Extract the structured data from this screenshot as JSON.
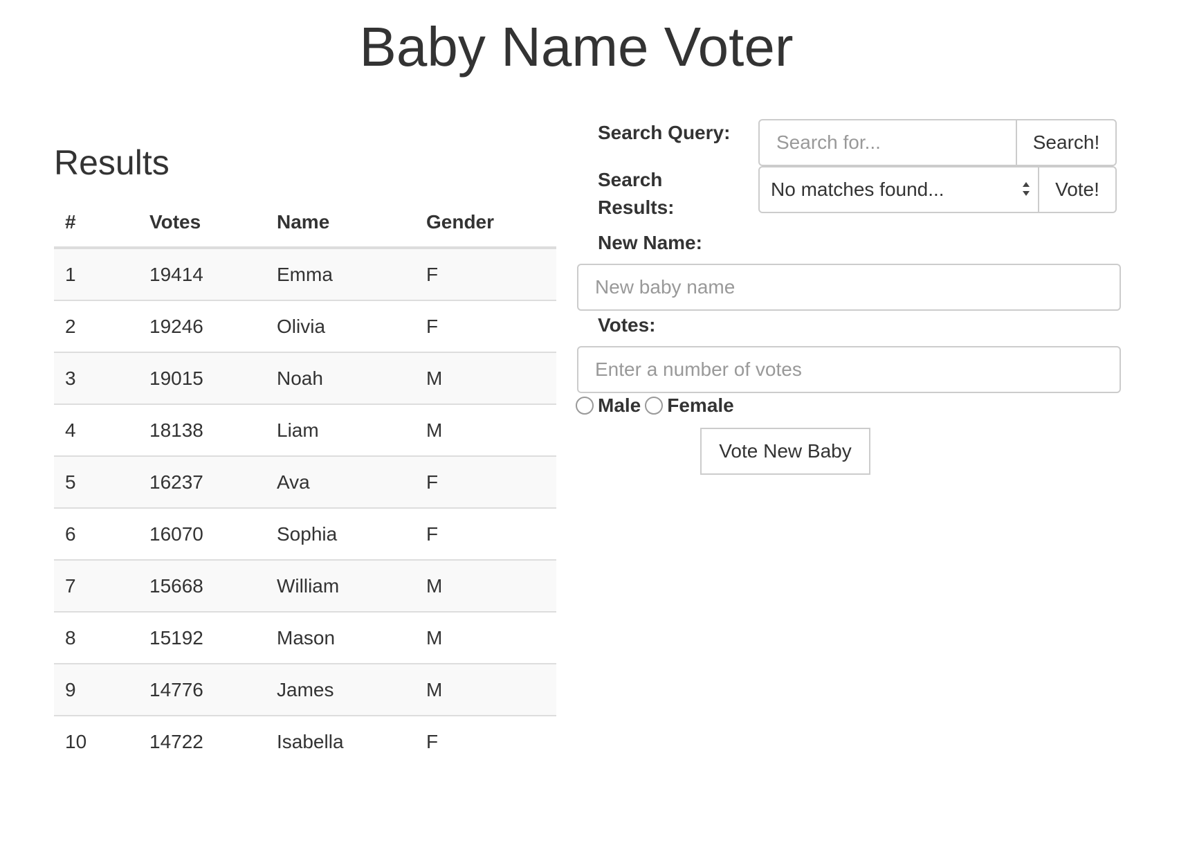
{
  "header": {
    "title": "Baby Name Voter"
  },
  "results": {
    "heading": "Results",
    "columns": [
      "#",
      "Votes",
      "Name",
      "Gender"
    ],
    "rows": [
      [
        "1",
        "19414",
        "Emma",
        "F"
      ],
      [
        "2",
        "19246",
        "Olivia",
        "F"
      ],
      [
        "3",
        "19015",
        "Noah",
        "M"
      ],
      [
        "4",
        "18138",
        "Liam",
        "M"
      ],
      [
        "5",
        "16237",
        "Ava",
        "F"
      ],
      [
        "6",
        "16070",
        "Sophia",
        "F"
      ],
      [
        "7",
        "15668",
        "William",
        "M"
      ],
      [
        "8",
        "15192",
        "Mason",
        "M"
      ],
      [
        "9",
        "14776",
        "James",
        "M"
      ],
      [
        "10",
        "14722",
        "Isabella",
        "F"
      ]
    ]
  },
  "search": {
    "query_label": "Search Query:",
    "query_placeholder": "Search for...",
    "query_value": "",
    "search_button": "Search!",
    "results_label_line1": "Search",
    "results_label_line2": "Results:",
    "results_selected": "No matches found...",
    "vote_button": "Vote!"
  },
  "new_name": {
    "name_label": "New Name:",
    "name_placeholder": "New baby name",
    "name_value": "",
    "votes_label": "Votes:",
    "votes_placeholder": "Enter a number of votes",
    "votes_value": "",
    "gender_options": [
      "Male",
      "Female"
    ],
    "submit_button": "Vote New Baby"
  },
  "colors": {
    "text": "#333333",
    "border": "#cccccc",
    "stripe": "#f9f9f9",
    "placeholder": "#999999"
  }
}
